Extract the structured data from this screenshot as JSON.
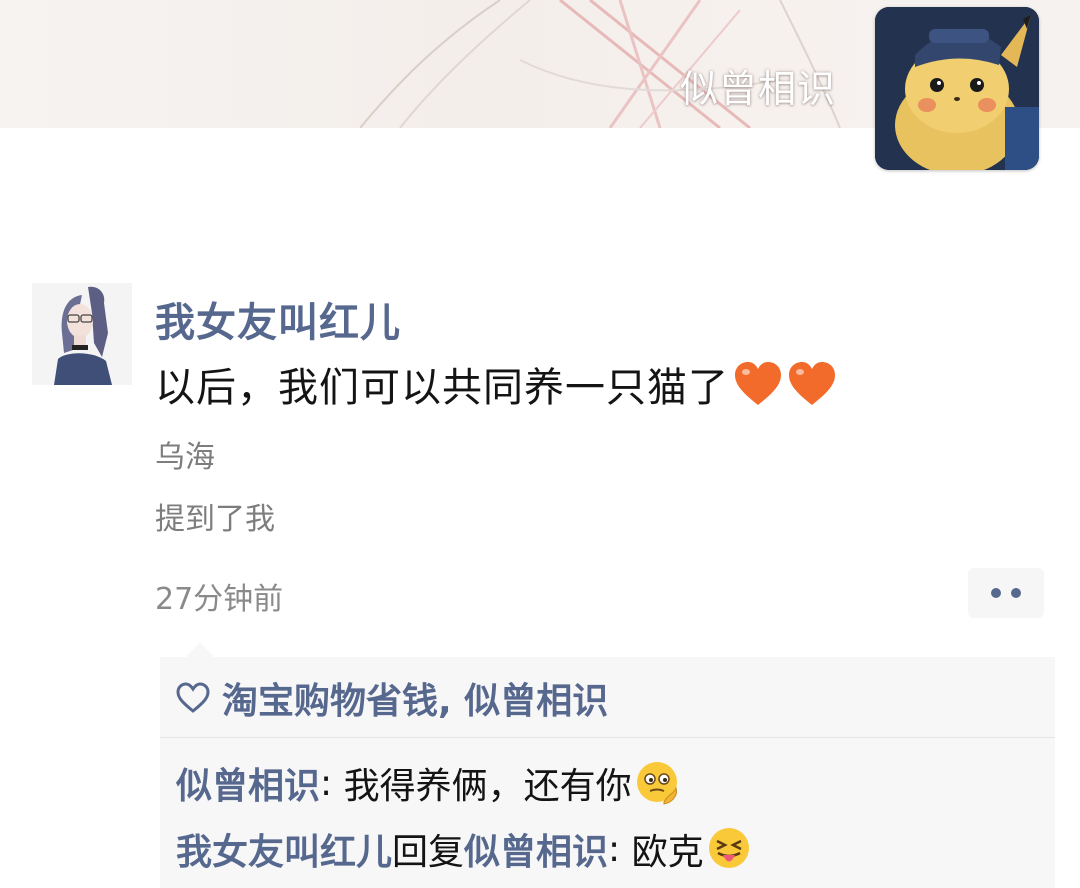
{
  "cover": {
    "nickname": "似曾相识",
    "avatar_icon": "pikachu-avatar"
  },
  "post": {
    "author": "我女友叫红儿",
    "avatar_icon": "girl-portrait-avatar",
    "text": "以后，我们可以共同养一只猫了",
    "trailing_icons": [
      "orange-heart-icon",
      "orange-heart-icon"
    ],
    "location": "乌海",
    "mention": "提到了我",
    "time": "27分钟前",
    "more_icon": "more-dots-icon"
  },
  "likes": {
    "icon": "heart-outline-icon",
    "names": "淘宝购物省钱, 似曾相识"
  },
  "comments": [
    {
      "author": "似曾相识",
      "separator": ": ",
      "text": "我得养俩，还有你",
      "emoji": "thinking-face-emoji"
    },
    {
      "author": "我女友叫红儿",
      "reply_word": "回复",
      "reply_to": "似曾相识",
      "separator": ": ",
      "text": "欧克",
      "emoji": "squinting-tongue-emoji"
    }
  ],
  "colors": {
    "name_link": "#57688f",
    "body_text": "#141414",
    "secondary_text": "#7d7d7d",
    "heart": "#f26b2a",
    "panel_bg": "#f7f7f7"
  }
}
